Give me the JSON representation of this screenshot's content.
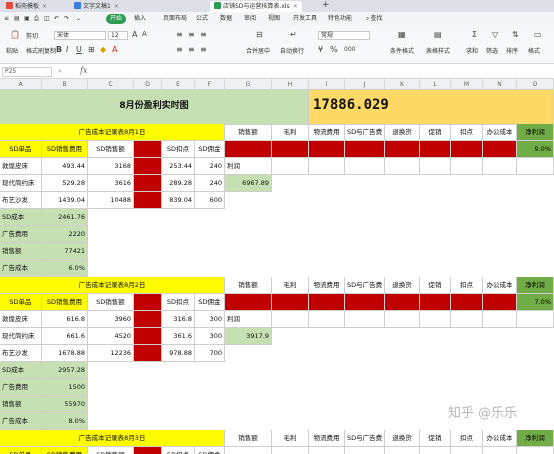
{
  "tabs": [
    {
      "label": "稻壳模板",
      "color": "#e34b3e"
    },
    {
      "label": "文字文稿1",
      "color": "#3b7ddd"
    },
    {
      "label": "店铺SD与运营核算表.xls",
      "color": "#2c9a52"
    }
  ],
  "menu": {
    "start": "开始",
    "items": [
      "插入",
      "页面布局",
      "公式",
      "数据",
      "审阅",
      "视图",
      "开发工具",
      "特色功能"
    ],
    "search": "查找"
  },
  "ribbon": {
    "paste": "粘贴",
    "cut": "剪切",
    "format_painter": "格式刷",
    "copy": "复制",
    "font": "宋体",
    "font_size": "12",
    "merge_center": "合并居中",
    "auto_wrap": "自动换行",
    "number_format": "常规",
    "conditional_format": "条件格式",
    "table_style": "表格样式",
    "sum": "求和",
    "filter": "筛选",
    "sort": "排序",
    "format": "格式"
  },
  "formula_bar": {
    "cell_ref": "P25",
    "fx": "fx"
  },
  "columns": [
    "A",
    "B",
    "C",
    "D",
    "E",
    "F",
    "G",
    "H",
    "I",
    "J",
    "K",
    "L",
    "M",
    "N",
    "O"
  ],
  "sheet": {
    "title": "8月份盈利实时图",
    "total": "17886.029",
    "summary_headers": [
      "销售额",
      "毛利",
      "物流费用",
      "SD与广告费",
      "退换货",
      "促销",
      "扣点",
      "办公成本",
      "净利润"
    ],
    "section_label": "利润",
    "sections": [
      {
        "heading": "广告成本记录表8月1日",
        "col_headers": [
          "SD单品",
          "SD销售费用",
          "SD销售额",
          "",
          "SD扣点",
          "SD佣金"
        ],
        "products": [
          {
            "name": "敦煌皮床",
            "cost": "493.44",
            "sales": "3168",
            "deduct": "253.44",
            "comm": "240"
          },
          {
            "name": "现代简约床",
            "cost": "529.28",
            "sales": "3616",
            "deduct": "289.28",
            "comm": "240"
          },
          {
            "name": "布艺沙发",
            "cost": "1439.04",
            "sales": "10488",
            "deduct": "839.04",
            "comm": "600"
          }
        ],
        "stats": [
          {
            "label": "SD成本",
            "value": "2461.76"
          },
          {
            "label": "广告费用",
            "value": "2220"
          },
          {
            "label": "销售额",
            "value": "77421"
          },
          {
            "label": "广告成本",
            "value": "6.0%"
          }
        ],
        "net_profit_pct": "9.0%",
        "profit": "6967.89"
      },
      {
        "heading": "广告成本记录表8月2日",
        "col_headers": [
          "SD单品",
          "SD销售费用",
          "SD销售额",
          "",
          "SD扣点",
          "SD佣金"
        ],
        "products": [
          {
            "name": "敦煌皮床",
            "cost": "616.8",
            "sales": "3960",
            "deduct": "316.8",
            "comm": "300"
          },
          {
            "name": "现代简约床",
            "cost": "661.6",
            "sales": "4520",
            "deduct": "361.6",
            "comm": "300"
          },
          {
            "name": "布艺沙发",
            "cost": "1678.88",
            "sales": "12236",
            "deduct": "978.88",
            "comm": "700"
          }
        ],
        "stats": [
          {
            "label": "SD成本",
            "value": "2957.28"
          },
          {
            "label": "广告费用",
            "value": "1500"
          },
          {
            "label": "销售额",
            "value": "55970"
          },
          {
            "label": "广告成本",
            "value": "8.0%"
          }
        ],
        "net_profit_pct": "7.0%",
        "profit": "3917.9"
      },
      {
        "heading": "广告成本记录表8月3日",
        "col_headers": [
          "SD单品",
          "SD销售费用",
          "SD销售额",
          "",
          "SD扣点",
          "SD佣金"
        ]
      }
    ]
  },
  "watermark": "知乎 @乐乐"
}
